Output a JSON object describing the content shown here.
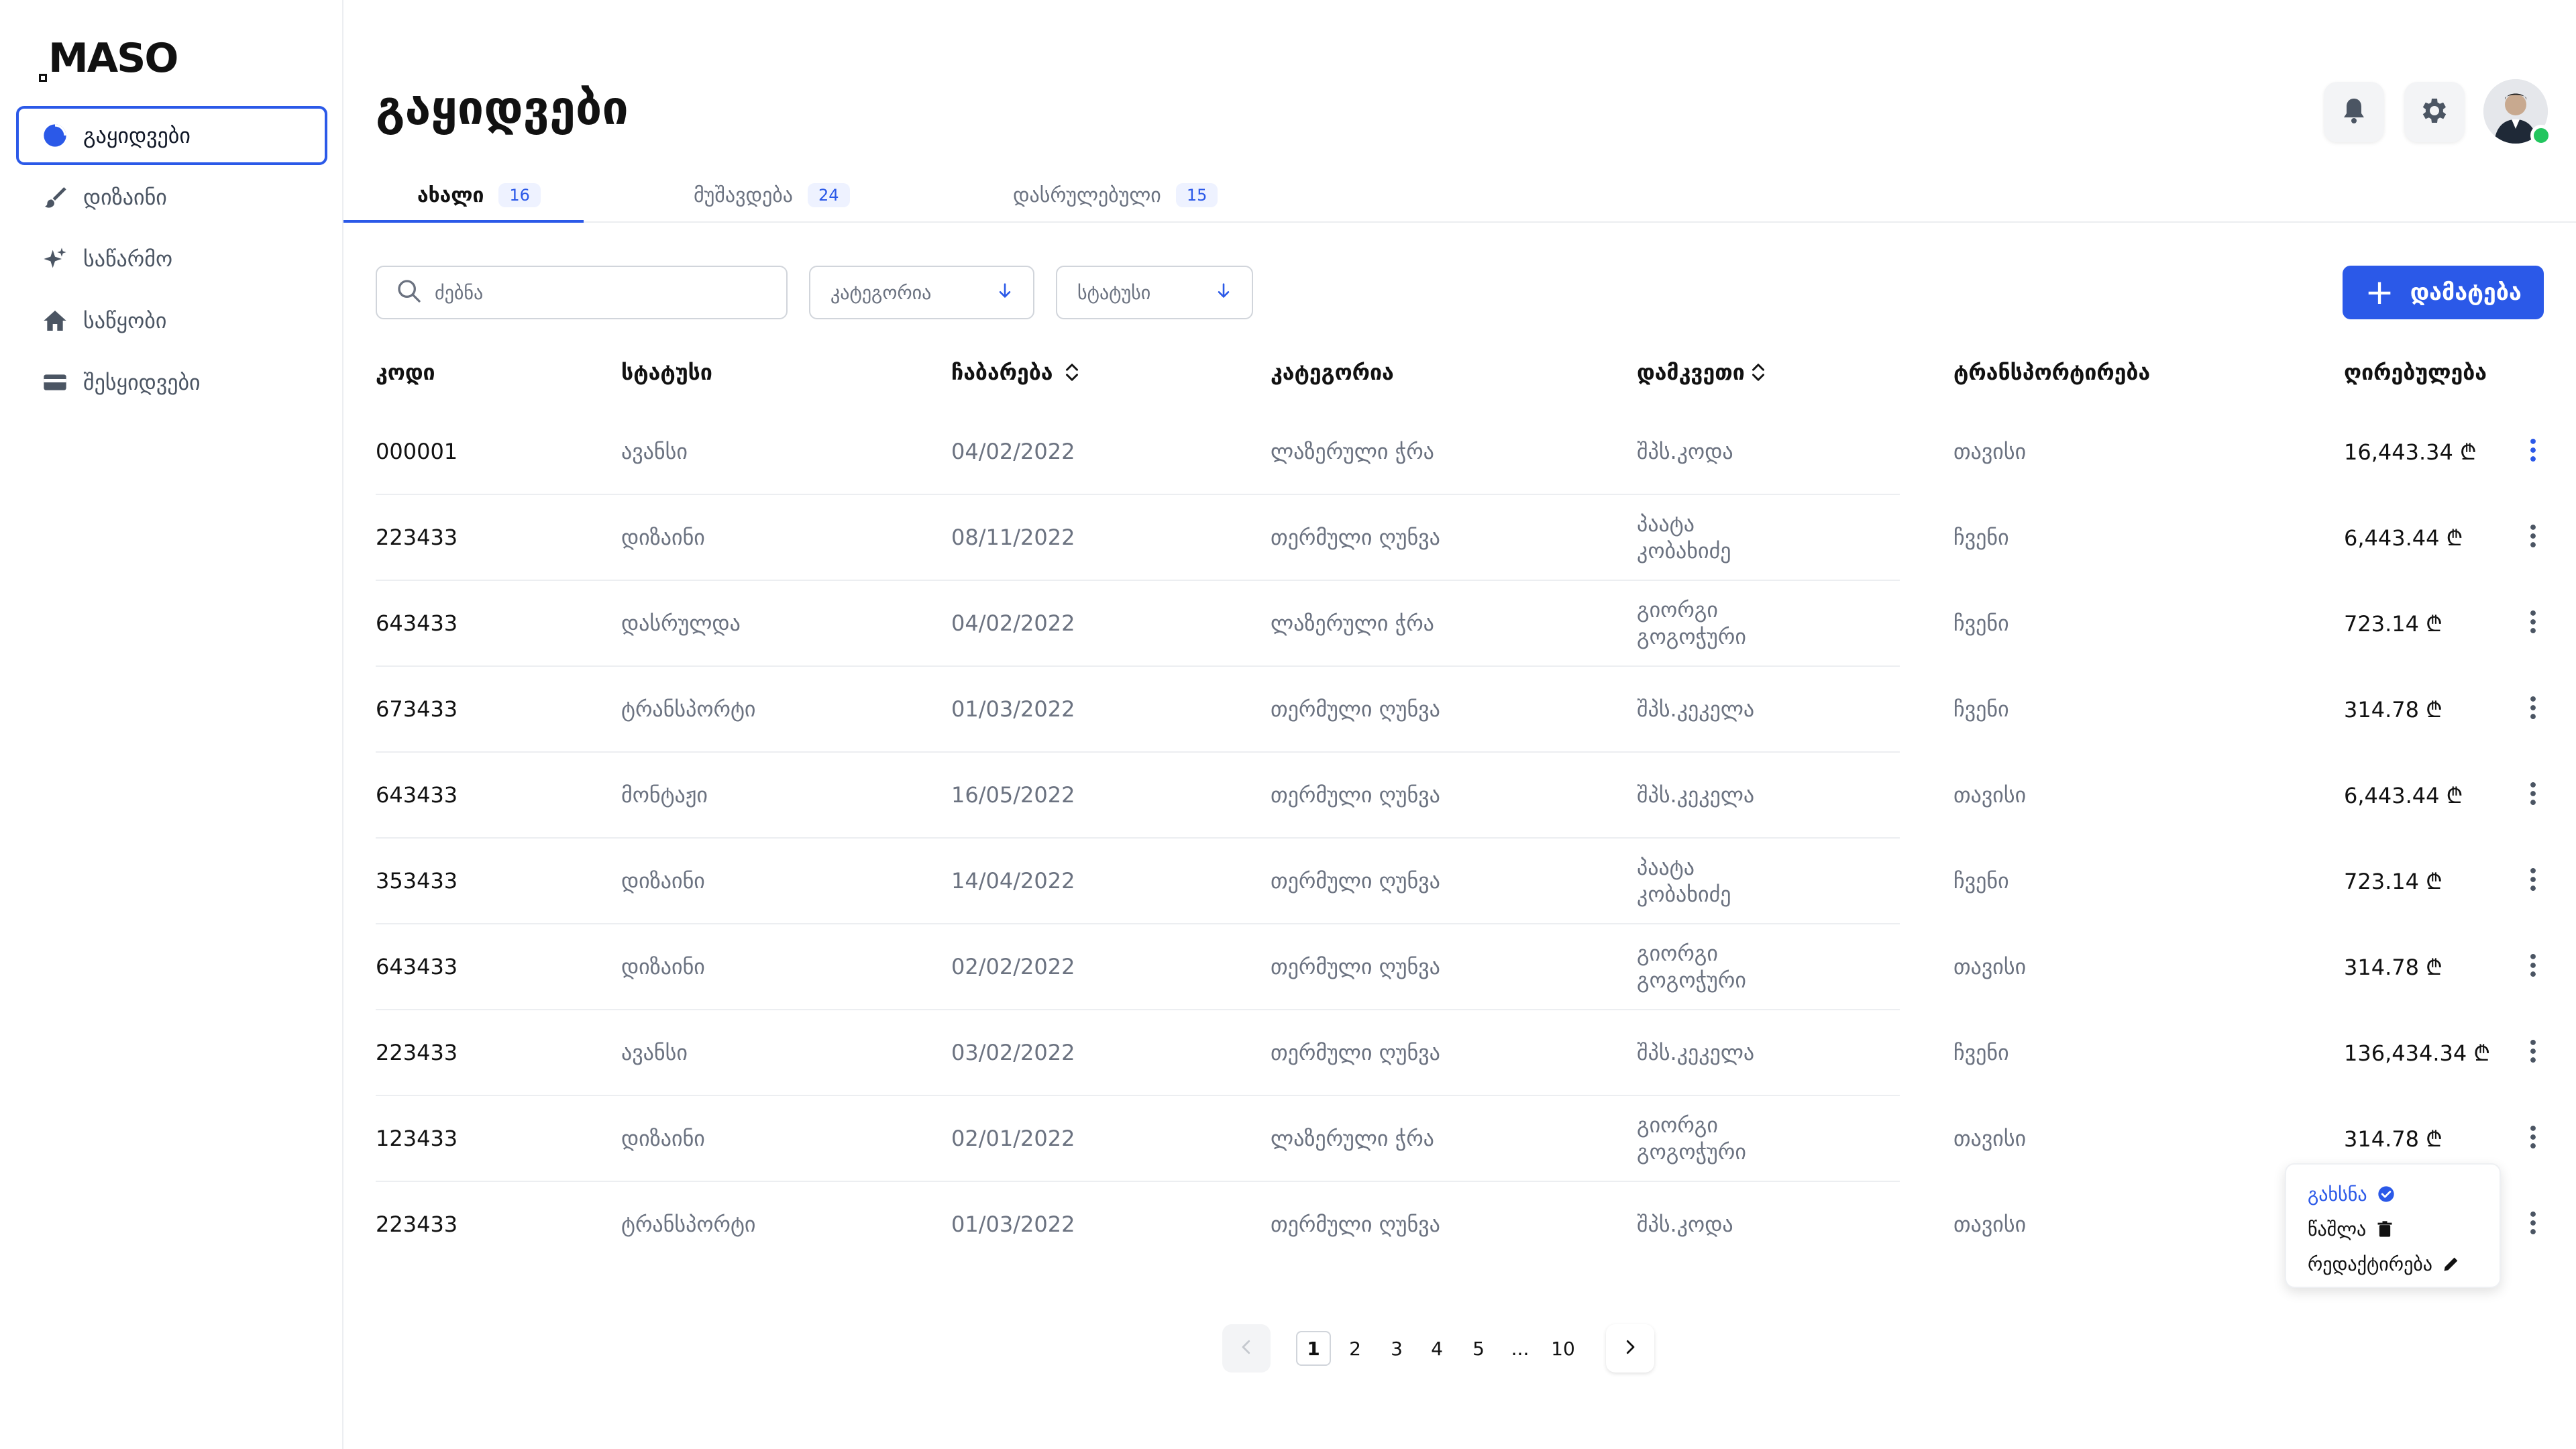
{
  "logo": "MASO",
  "page_title": "გაყიდვები",
  "sidebar": {
    "items": [
      {
        "label": "გაყიდვები",
        "icon": "pie-chart-icon",
        "active": true
      },
      {
        "label": "დიზაინი",
        "icon": "brush-icon",
        "active": false
      },
      {
        "label": "საწარმო",
        "icon": "sparkles-icon",
        "active": false
      },
      {
        "label": "საწყობი",
        "icon": "home-icon",
        "active": false
      },
      {
        "label": "შესყიდვები",
        "icon": "credit-card-icon",
        "active": false
      }
    ]
  },
  "header_icons": [
    "bell-icon",
    "gear-icon",
    "avatar"
  ],
  "tabs": [
    {
      "label": "ახალი",
      "count": "16",
      "active": true
    },
    {
      "label": "მუშავდება",
      "count": "24",
      "active": false
    },
    {
      "label": "დასრულებული",
      "count": "15",
      "active": false
    }
  ],
  "toolbar": {
    "search_placeholder": "ძებნა",
    "category_label": "კატეგორია",
    "status_label": "სტატუსი",
    "add_label": "დამატება"
  },
  "table": {
    "headers": {
      "code": "კოდი",
      "status": "სტატუსი",
      "delivery": "ჩაბარება",
      "category": "კატეგორია",
      "customer": "დამკვეთი",
      "transport": "ტრანსპორტირება",
      "price": "ღირებულება"
    },
    "rows": [
      {
        "code": "000001",
        "status": "ავანსი",
        "date": "04/02/2022",
        "category": "ლაზერული ჭრა",
        "customer": "შპს.კოდა",
        "transport": "თავისი",
        "price": "16,443.34 ₾"
      },
      {
        "code": "223433",
        "status": "დიზაინი",
        "date": "08/11/2022",
        "category": "თერმული ღუნვა",
        "customer": "პაატა კობახიძე",
        "transport": "ჩვენი",
        "price": "6,443.44 ₾"
      },
      {
        "code": "643433",
        "status": "დასრულდა",
        "date": "04/02/2022",
        "category": "ლაზერული ჭრა",
        "customer": "გიორგი გოგოჭური",
        "transport": "ჩვენი",
        "price": "723.14 ₾"
      },
      {
        "code": "673433",
        "status": "ტრანსპორტი",
        "date": "01/03/2022",
        "category": "თერმული ღუნვა",
        "customer": "შპს.კეკელა",
        "transport": "ჩვენი",
        "price": "314.78 ₾"
      },
      {
        "code": "643433",
        "status": "მონტაჟი",
        "date": "16/05/2022",
        "category": "თერმული ღუნვა",
        "customer": "შპს.კეკელა",
        "transport": "თავისი",
        "price": "6,443.44 ₾"
      },
      {
        "code": "353433",
        "status": "დიზაინი",
        "date": "14/04/2022",
        "category": "თერმული ღუნვა",
        "customer": "პაატა კობახიძე",
        "transport": "ჩვენი",
        "price": "723.14 ₾"
      },
      {
        "code": "643433",
        "status": "დიზაინი",
        "date": "02/02/2022",
        "category": "თერმული ღუნვა",
        "customer": "გიორგი გოგოჭური",
        "transport": "თავისი",
        "price": "314.78 ₾"
      },
      {
        "code": "223433",
        "status": "ავანსი",
        "date": "03/02/2022",
        "category": "თერმული ღუნვა",
        "customer": "შპს.კეკელა",
        "transport": "ჩვენი",
        "price": "136,434.34 ₾"
      },
      {
        "code": "123433",
        "status": "დიზაინი",
        "date": "02/01/2022",
        "category": "ლაზერული ჭრა",
        "customer": "გიორგი გოგოჭური",
        "transport": "თავისი",
        "price": "314.78 ₾"
      },
      {
        "code": "223433",
        "status": "ტრანსპორტი",
        "date": "01/03/2022",
        "category": "თერმული ღუნვა",
        "customer": "შპს.კოდა",
        "transport": "თავისი",
        "price": ""
      }
    ]
  },
  "context_menu": {
    "items": [
      {
        "label": "გახსნა",
        "icon": "check-circle-icon"
      },
      {
        "label": "წაშლა",
        "icon": "trash-icon"
      },
      {
        "label": "რედაქტირება",
        "icon": "pencil-icon"
      }
    ]
  },
  "pagination": {
    "pages": [
      "1",
      "2",
      "3",
      "4",
      "5",
      "...",
      "10"
    ],
    "current": "1"
  },
  "colors": {
    "accent": "#2b59e8",
    "online": "#22c55e",
    "muted_text": "#6b7280"
  }
}
